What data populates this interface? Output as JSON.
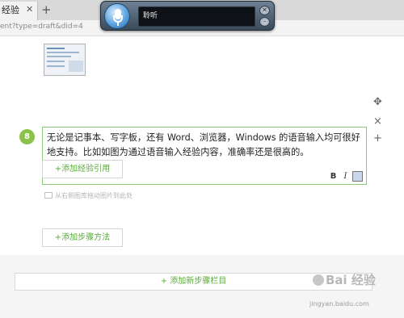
{
  "browser": {
    "tab_title": "经验",
    "tab_close": "✕",
    "new_tab": "+",
    "url": "ent?type=draft&did=4"
  },
  "speech": {
    "status": "聆听",
    "close": "✕",
    "minimize": "–"
  },
  "editor": {
    "step_number": "8",
    "step_text": "无论是记事本、写字板，还有 Word、浏览器，Windows 的语音输入均可很好地支持。比如如图为通过语音输入经验内容，准确率还是很高的。",
    "bold": "B",
    "italic": "I",
    "move": "✥",
    "delete": "×",
    "add": "+"
  },
  "buttons": {
    "add_reference": "+添加经验引用",
    "add_step_method": "+添加步骤方法",
    "add_new_step_section": "+ 添加新步骤栏目"
  },
  "hint": "从右侧图库拖动图片到此处",
  "watermark": {
    "brand": "Bai 经验",
    "site": "jingyan.baidu.com"
  },
  "colors": {
    "accent_green": "#8bc34a",
    "link_green": "#5aab3a"
  }
}
